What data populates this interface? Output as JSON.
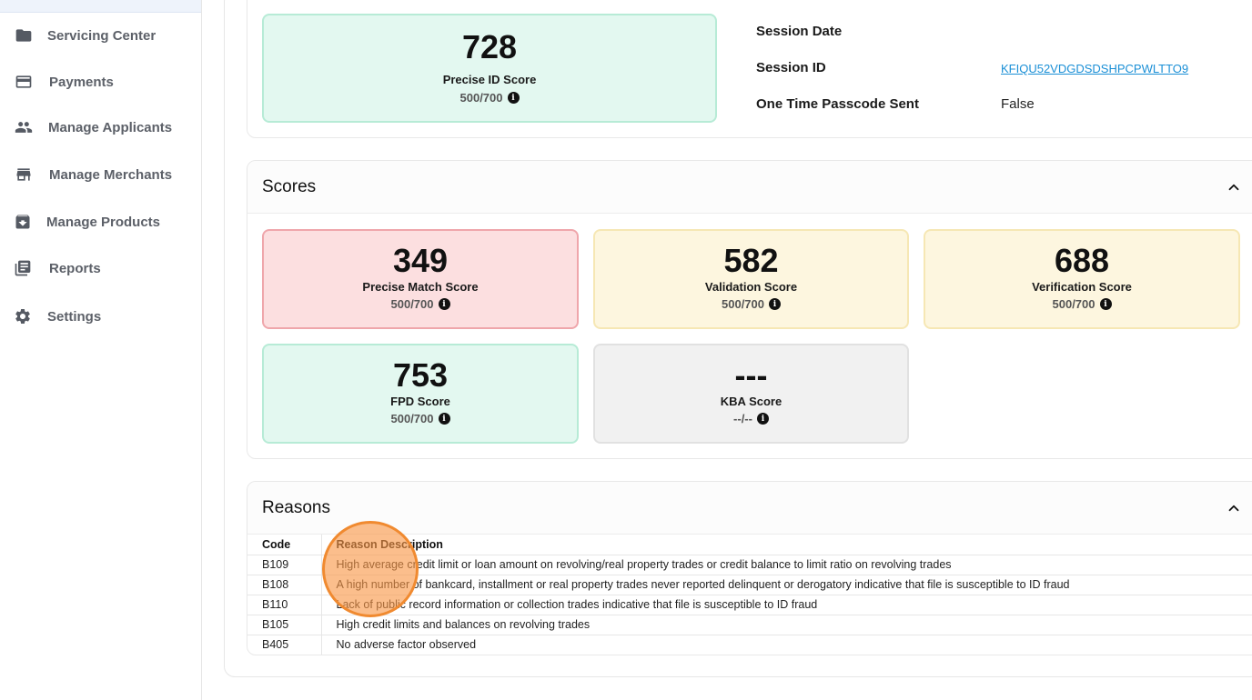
{
  "sidebar": {
    "items": [
      {
        "label": "Servicing Center",
        "icon": "folder-icon"
      },
      {
        "label": "Payments",
        "icon": "credit-card-icon"
      },
      {
        "label": "Manage Applicants",
        "icon": "people-icon"
      },
      {
        "label": "Manage Merchants",
        "icon": "storefront-icon"
      },
      {
        "label": "Manage Products",
        "icon": "archive-icon"
      },
      {
        "label": "Reports",
        "icon": "library-books-icon"
      },
      {
        "label": "Settings",
        "icon": "gear-icon"
      }
    ]
  },
  "precise_id": {
    "value": "728",
    "label": "Precise ID Score",
    "range": "500/700"
  },
  "session": {
    "date_label": "Session Date",
    "date_value": "",
    "id_label": "Session ID",
    "id_value": "KFIQU52VDGDSDSHPCPWLTTO9",
    "otp_label": "One Time Passcode Sent",
    "otp_value": "False"
  },
  "scores": {
    "title": "Scores",
    "cards": [
      {
        "value": "349",
        "label": "Precise Match Score",
        "range": "500/700",
        "status": "red"
      },
      {
        "value": "582",
        "label": "Validation Score",
        "range": "500/700",
        "status": "yellow"
      },
      {
        "value": "688",
        "label": "Verification Score",
        "range": "500/700",
        "status": "yellow"
      },
      {
        "value": "753",
        "label": "FPD Score",
        "range": "500/700",
        "status": "green"
      },
      {
        "value": "---",
        "label": "KBA Score",
        "range": "--/--",
        "status": "gray"
      }
    ]
  },
  "reasons": {
    "title": "Reasons",
    "columns": [
      "Code",
      "Reason Description"
    ],
    "rows": [
      {
        "code": "B109",
        "description": "High average credit limit or loan amount on revolving/real property trades or credit balance to limit ratio on revolving trades"
      },
      {
        "code": "B108",
        "description": "A high number of bankcard, installment or real property trades never reported delinquent or derogatory indicative that file is susceptible to ID fraud"
      },
      {
        "code": "B110",
        "description": "Lack of public record information or collection trades indicative that file is susceptible to ID fraud"
      },
      {
        "code": "B105",
        "description": "High credit limits and balances on revolving trades"
      },
      {
        "code": "B405",
        "description": "No adverse factor observed"
      }
    ]
  },
  "colors": {
    "green_bg": "#e3f8f0",
    "red_bg": "#fcdfe0",
    "yellow_bg": "#fdf6df",
    "gray_bg": "#f1f1f1",
    "link": "#1a8fd6",
    "click_marker": "#f08a30"
  }
}
